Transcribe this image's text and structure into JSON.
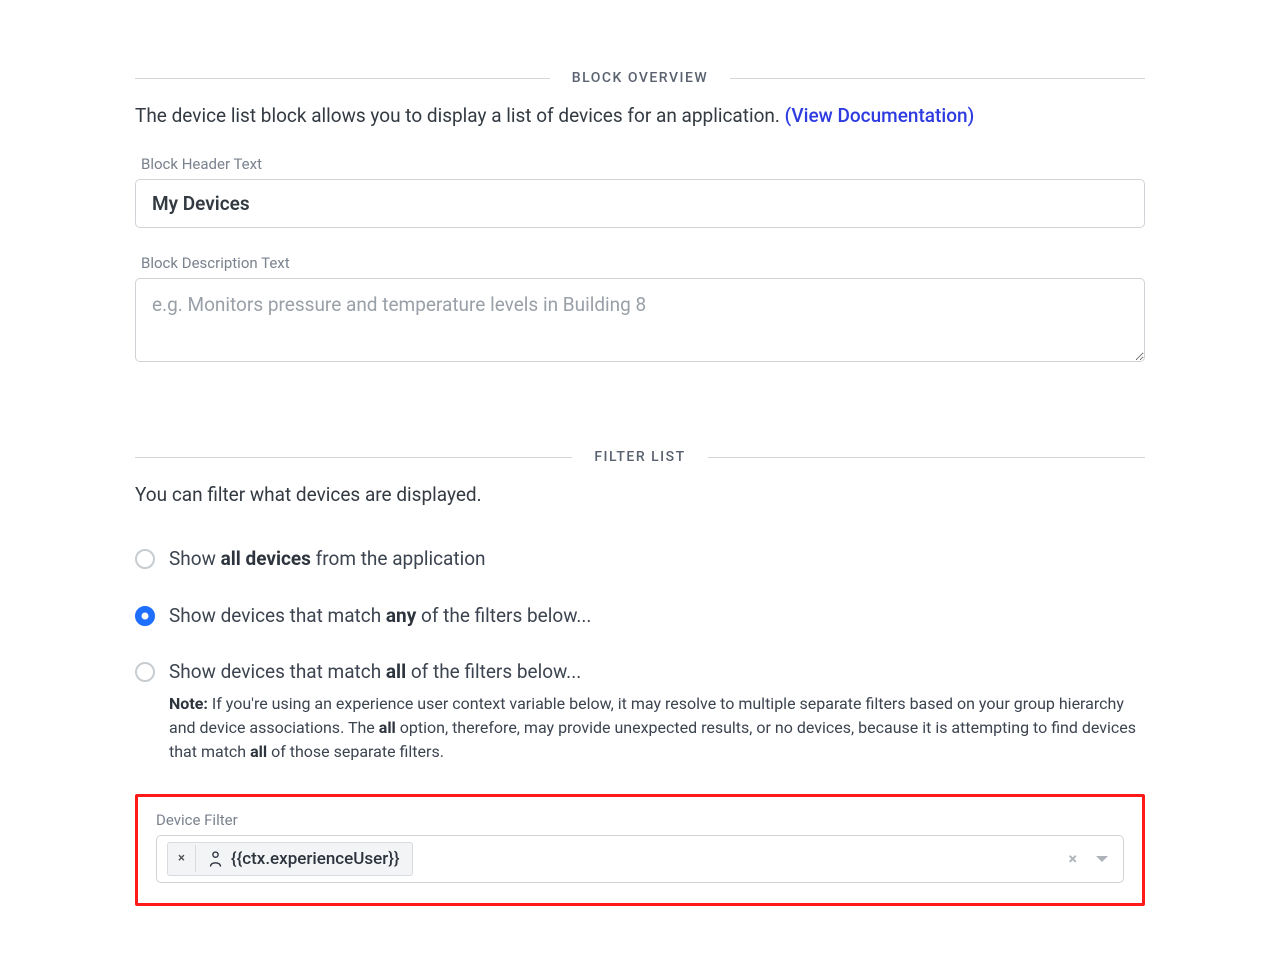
{
  "sections": {
    "overview": {
      "title": "BLOCK OVERVIEW",
      "intro_prefix": "The device list block allows you to display a list of devices for an application. ",
      "doc_link_text": "(View Documentation)"
    },
    "filter": {
      "title": "FILTER LIST",
      "intro": "You can filter what devices are displayed."
    }
  },
  "fields": {
    "header_label": "Block Header Text",
    "header_value": "My Devices",
    "description_label": "Block Description Text",
    "description_placeholder": "e.g. Monitors pressure and temperature levels in Building 8",
    "description_value": ""
  },
  "radios": {
    "all": {
      "pre": "Show ",
      "bold": "all devices",
      "post": " from the application",
      "selected": false
    },
    "any": {
      "pre": "Show devices that match ",
      "bold": "any",
      "post": " of the filters below...",
      "selected": true
    },
    "allof": {
      "pre": "Show devices that match ",
      "bold": "all",
      "post": " of the filters below...",
      "selected": false,
      "note_label": "Note:",
      "note_pre": " If you're using an experience user context variable below, it may resolve to multiple separate filters based on your group hierarchy and device associations. The ",
      "note_bold1": "all",
      "note_mid": " option, therefore, may provide unexpected results, or no devices, because it is attempting to find devices that match ",
      "note_bold2": "all",
      "note_post": " of those separate filters."
    }
  },
  "device_filter": {
    "label": "Device Filter",
    "tag_text": "{{ctx.experienceUser}}",
    "tag_close": "×",
    "clear": "×"
  }
}
